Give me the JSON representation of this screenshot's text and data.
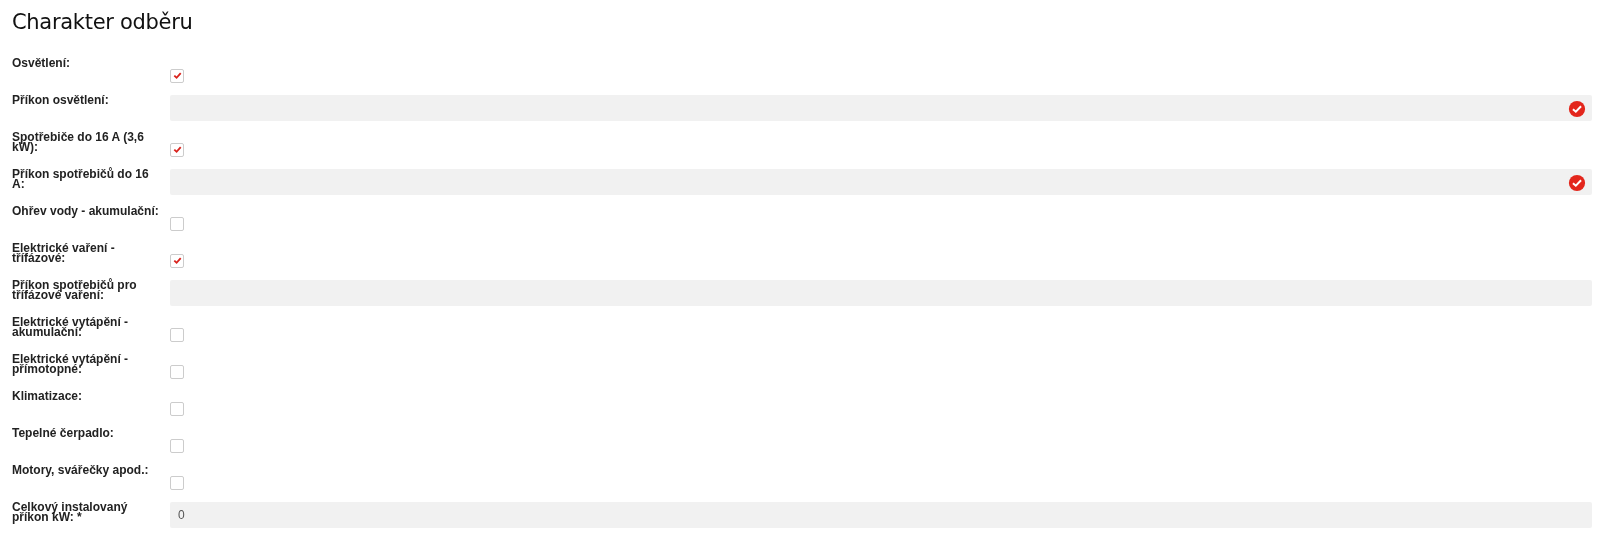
{
  "title": "Charakter odběru",
  "fields": [
    {
      "kind": "checkbox",
      "label": "Osvětlení:",
      "checked": true
    },
    {
      "kind": "input",
      "label": "Příkon osvětlení:",
      "valid": true
    },
    {
      "kind": "checkbox",
      "label": "Spotřebiče do 16 A (3,6 kW):",
      "checked": true
    },
    {
      "kind": "input",
      "label": "Příkon spotřebičů do 16 A:",
      "valid": true
    },
    {
      "kind": "checkbox",
      "label": "Ohřev vody - akumulační:",
      "checked": false
    },
    {
      "kind": "checkbox",
      "label": "Elektrické vaření - třífázové:",
      "checked": true
    },
    {
      "kind": "input",
      "label": "Příkon spotřebičů pro třífázové vaření:",
      "valid": false
    },
    {
      "kind": "checkbox",
      "label": "Elektrické vytápění - akumulační:",
      "checked": false
    },
    {
      "kind": "checkbox",
      "label": "Elektrické vytápění - přímotopné:",
      "checked": false
    },
    {
      "kind": "checkbox",
      "label": "Klimatizace:",
      "checked": false
    },
    {
      "kind": "checkbox",
      "label": "Tepelné čerpadlo:",
      "checked": false
    },
    {
      "kind": "checkbox",
      "label": "Motory, svářečky apod.:",
      "checked": false
    },
    {
      "kind": "input",
      "label": "Celkový instalovaný příkon kW: *",
      "value": "0",
      "valid": false
    }
  ]
}
